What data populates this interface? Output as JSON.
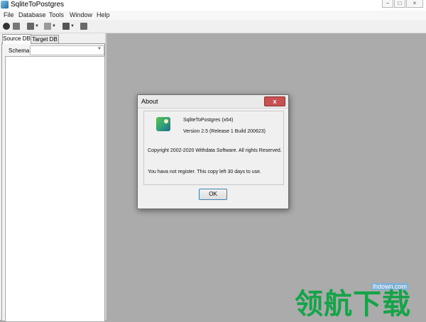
{
  "window": {
    "title": "SqliteToPostgres",
    "controls": [
      "−",
      "□",
      "×"
    ]
  },
  "menu": [
    "File",
    "Database",
    "Tools",
    "Window",
    "Help"
  ],
  "toolbar": {
    "icons": [
      "connect-icon",
      "disconnect-icon",
      "table-icon",
      "query-icon",
      "grid-icon",
      "stop-icon"
    ]
  },
  "left_pane": {
    "tabs": [
      "Source DB",
      "Target DB"
    ],
    "active_tab": "Source DB",
    "schema_label": "Schema",
    "schema_value": ""
  },
  "about_dialog": {
    "title": "About",
    "close_label": "x",
    "product": "SqliteToPostgres (x64)",
    "version": "Version 2.5 (Release 1 Build 200623)",
    "copyright": "Copyright 2002-2020 Withdata Software.  All rights Reserved.",
    "register_note": "You hava not register. This copy left 30 days to use.",
    "ok_label": "OK"
  },
  "watermark": {
    "url": "lhdown.com",
    "text": "领航下载"
  }
}
